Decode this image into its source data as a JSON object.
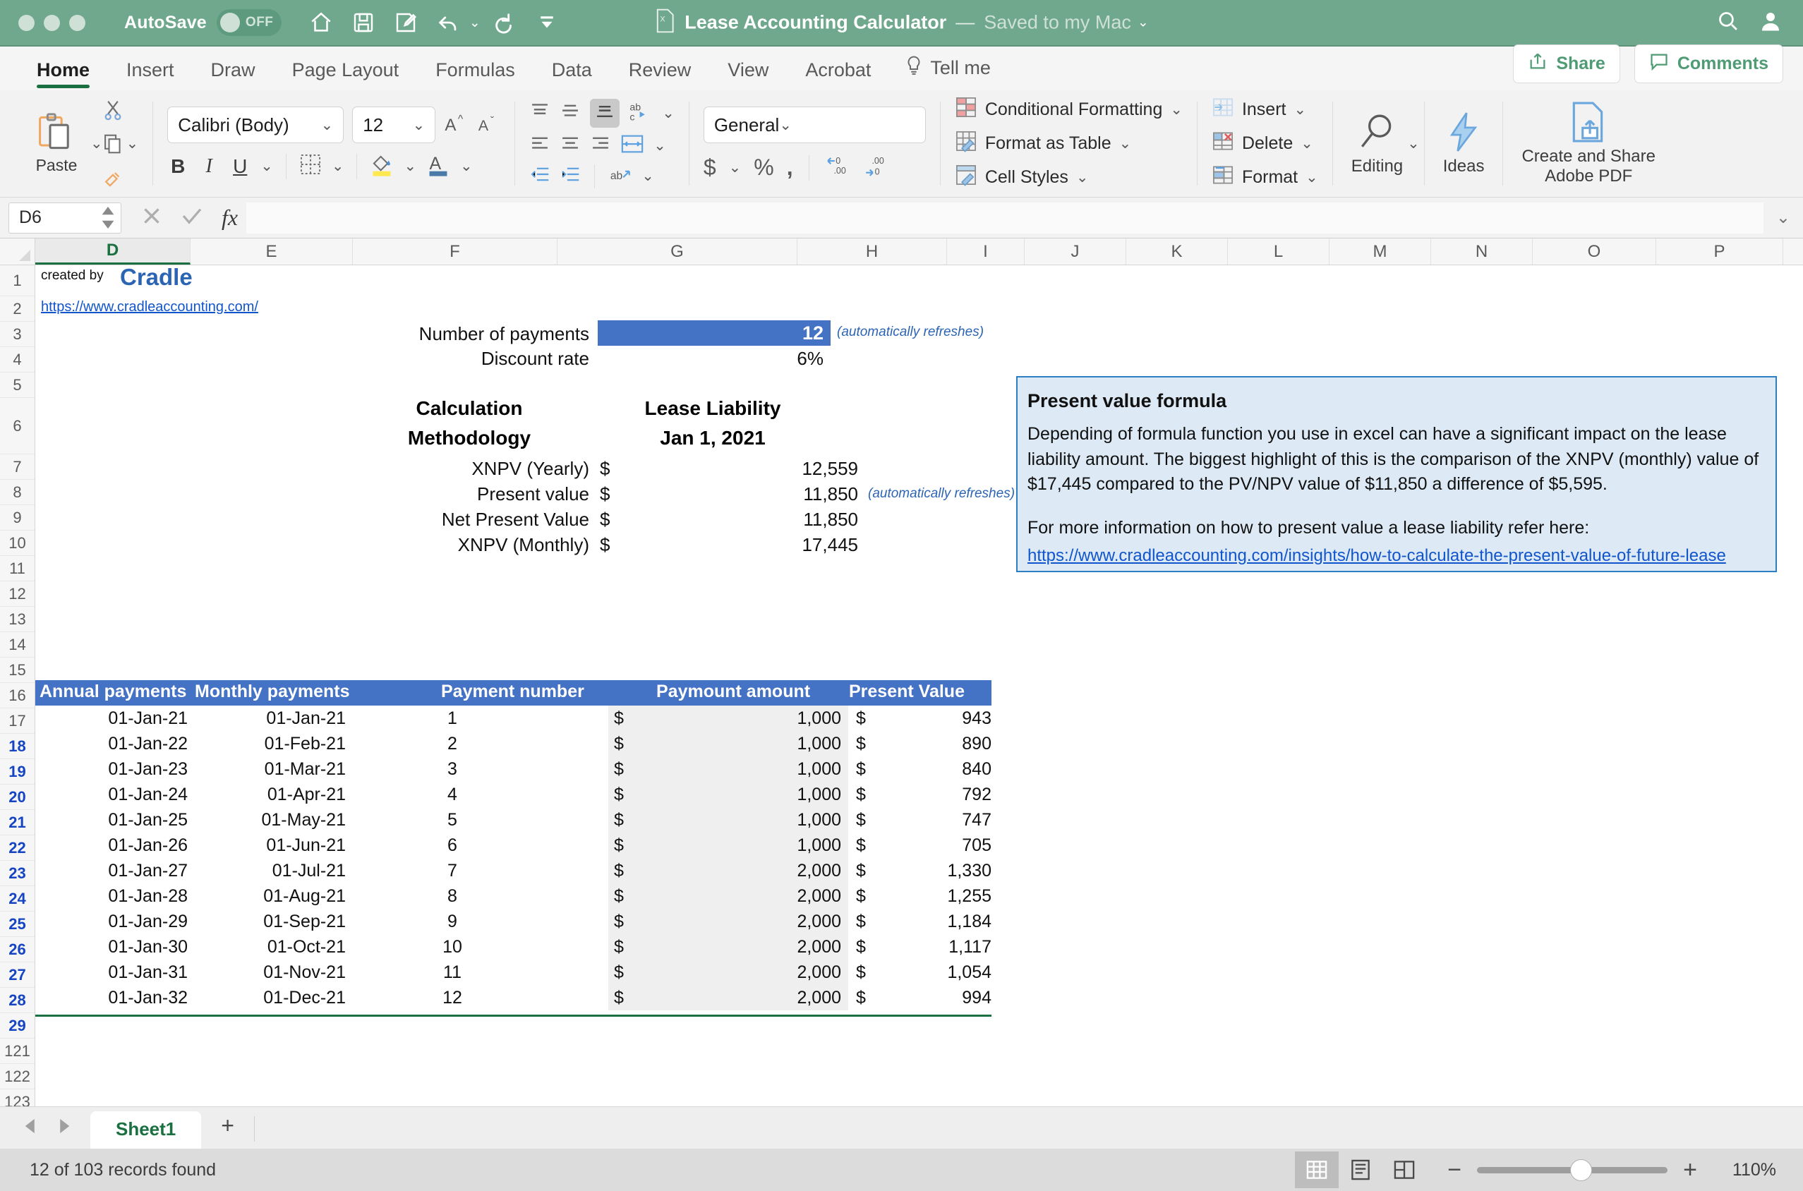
{
  "titlebar": {
    "autosave_label": "AutoSave",
    "autosave_state": "OFF",
    "doc_name": "Lease Accounting Calculator",
    "dash": "—",
    "saved_status": "Saved to my Mac",
    "quick_access": [
      "home-icon",
      "save-icon",
      "save-edit-icon",
      "undo-icon",
      "redo-icon",
      "customize-icon"
    ],
    "right_icons": [
      "search-icon",
      "account-icon"
    ]
  },
  "ribbon_tabs": {
    "tabs": [
      "Home",
      "Insert",
      "Draw",
      "Page Layout",
      "Formulas",
      "Data",
      "Review",
      "View",
      "Acrobat"
    ],
    "active": "Home",
    "tell_me": "Tell me",
    "share_label": "Share",
    "comments_label": "Comments"
  },
  "ribbon": {
    "paste_label": "Paste",
    "font_name": "Calibri (Body)",
    "font_size": "12",
    "bold": "B",
    "italic": "I",
    "underline": "U",
    "number_format": "General",
    "cell_styles": [
      {
        "label": "Conditional Formatting",
        "icon": "conditional-formatting-icon"
      },
      {
        "label": "Format as Table",
        "icon": "format-as-table-icon"
      },
      {
        "label": "Cell Styles",
        "icon": "cell-styles-icon"
      }
    ],
    "cells_group": [
      {
        "label": "Insert",
        "icon": "insert-cells-icon"
      },
      {
        "label": "Delete",
        "icon": "delete-cells-icon"
      },
      {
        "label": "Format",
        "icon": "format-cells-icon"
      }
    ],
    "editing_label": "Editing",
    "ideas_label": "Ideas",
    "adobe_label_line1": "Create and Share",
    "adobe_label_line2": "Adobe PDF"
  },
  "formula_bar": {
    "name_box": "D6",
    "cancel_icon": "cancel-icon",
    "confirm_icon": "confirm-icon",
    "fx_icon": "fx-icon",
    "formula_value": ""
  },
  "grid": {
    "columns": [
      "D",
      "E",
      "F",
      "G",
      "H",
      "I",
      "J",
      "K",
      "L",
      "M",
      "N",
      "O",
      "P"
    ],
    "selected_column": "D",
    "rows": [
      "1",
      "2",
      "3",
      "4",
      "5",
      "6",
      "7",
      "8",
      "9",
      "10",
      "11",
      "12",
      "13",
      "14",
      "15",
      "16",
      "17",
      "18",
      "19",
      "20",
      "21",
      "22",
      "23",
      "24",
      "25",
      "26",
      "27",
      "28",
      "29",
      "121",
      "122",
      "123"
    ],
    "active_rows": [
      "18",
      "19",
      "20",
      "21",
      "22",
      "23",
      "24",
      "25",
      "26",
      "27",
      "28",
      "29"
    ],
    "cells": {
      "created_by": "created by",
      "brand": "Cradle",
      "website": "https://www.cradleaccounting.com/",
      "number_of_payments_label": "Number of payments",
      "number_of_payments_value": "12",
      "number_of_payments_note": "(automatically refreshes)",
      "discount_rate_label": "Discount rate",
      "discount_rate_value": "6%",
      "calc_header_line1": "Calculation",
      "calc_header_line2": "Methodology",
      "liability_header_line1": "Lease Liability",
      "liability_header_line2": "Jan 1, 2021",
      "present_value_note": "(automatically refreshes)"
    },
    "summary_rows": [
      {
        "method": "XNPV (Yearly)",
        "currency": "$",
        "amount": "12,559",
        "note": ""
      },
      {
        "method": "Present value",
        "currency": "$",
        "amount": "11,850",
        "note": "(automatically refreshes)"
      },
      {
        "method": "Net Present Value",
        "currency": "$",
        "amount": "11,850",
        "note": ""
      },
      {
        "method": "XNPV (Monthly)",
        "currency": "$",
        "amount": "17,445",
        "note": ""
      }
    ],
    "info_box": {
      "title": "Present value formula",
      "body": "Depending of formula function you use in excel can have a significant impact on the lease liability amount. The biggest highlight of this is the comparison of the XNPV (monthly) value of $17,445 compared to the PV/NPV value of $11,850 a difference of $5,595.",
      "body2": "For more information on how to present value a lease liability refer here:",
      "link": "https://www.cradleaccounting.com/insights/how-to-calculate-the-present-value-of-future-lease"
    },
    "table": {
      "headers": [
        "Annual payments",
        "Monthly payments",
        "Payment number",
        "Paymount amount",
        "Present Value"
      ],
      "rows": [
        {
          "annual": "01-Jan-21",
          "monthly": "01-Jan-21",
          "num": "1",
          "cur1": "$",
          "amount": "1,000",
          "cur2": "$",
          "pv": "943"
        },
        {
          "annual": "01-Jan-22",
          "monthly": "01-Feb-21",
          "num": "2",
          "cur1": "$",
          "amount": "1,000",
          "cur2": "$",
          "pv": "890"
        },
        {
          "annual": "01-Jan-23",
          "monthly": "01-Mar-21",
          "num": "3",
          "cur1": "$",
          "amount": "1,000",
          "cur2": "$",
          "pv": "840"
        },
        {
          "annual": "01-Jan-24",
          "monthly": "01-Apr-21",
          "num": "4",
          "cur1": "$",
          "amount": "1,000",
          "cur2": "$",
          "pv": "792"
        },
        {
          "annual": "01-Jan-25",
          "monthly": "01-May-21",
          "num": "5",
          "cur1": "$",
          "amount": "1,000",
          "cur2": "$",
          "pv": "747"
        },
        {
          "annual": "01-Jan-26",
          "monthly": "01-Jun-21",
          "num": "6",
          "cur1": "$",
          "amount": "1,000",
          "cur2": "$",
          "pv": "705"
        },
        {
          "annual": "01-Jan-27",
          "monthly": "01-Jul-21",
          "num": "7",
          "cur1": "$",
          "amount": "2,000",
          "cur2": "$",
          "pv": "1,330"
        },
        {
          "annual": "01-Jan-28",
          "monthly": "01-Aug-21",
          "num": "8",
          "cur1": "$",
          "amount": "2,000",
          "cur2": "$",
          "pv": "1,255"
        },
        {
          "annual": "01-Jan-29",
          "monthly": "01-Sep-21",
          "num": "9",
          "cur1": "$",
          "amount": "2,000",
          "cur2": "$",
          "pv": "1,184"
        },
        {
          "annual": "01-Jan-30",
          "monthly": "01-Oct-21",
          "num": "10",
          "cur1": "$",
          "amount": "2,000",
          "cur2": "$",
          "pv": "1,117"
        },
        {
          "annual": "01-Jan-31",
          "monthly": "01-Nov-21",
          "num": "11",
          "cur1": "$",
          "amount": "2,000",
          "cur2": "$",
          "pv": "1,054"
        },
        {
          "annual": "01-Jan-32",
          "monthly": "01-Dec-21",
          "num": "12",
          "cur1": "$",
          "amount": "2,000",
          "cur2": "$",
          "pv": "994"
        }
      ]
    }
  },
  "bottom": {
    "sheet_tab": "Sheet1",
    "add_sheet": "+",
    "status_text": "12 of 103 records found",
    "zoom_pct": "110%",
    "zoom_minus": "−",
    "zoom_plus": "+",
    "view_buttons": [
      "normal-view-icon",
      "page-layout-view-icon",
      "page-break-view-icon"
    ]
  },
  "colors": {
    "titlebar": "#6fa88c",
    "accent_green": "#1a7040",
    "excel_blue": "#4472c4",
    "link_blue": "#1155cc",
    "info_bg": "#ddeaf6",
    "info_border": "#2b7ec1"
  }
}
